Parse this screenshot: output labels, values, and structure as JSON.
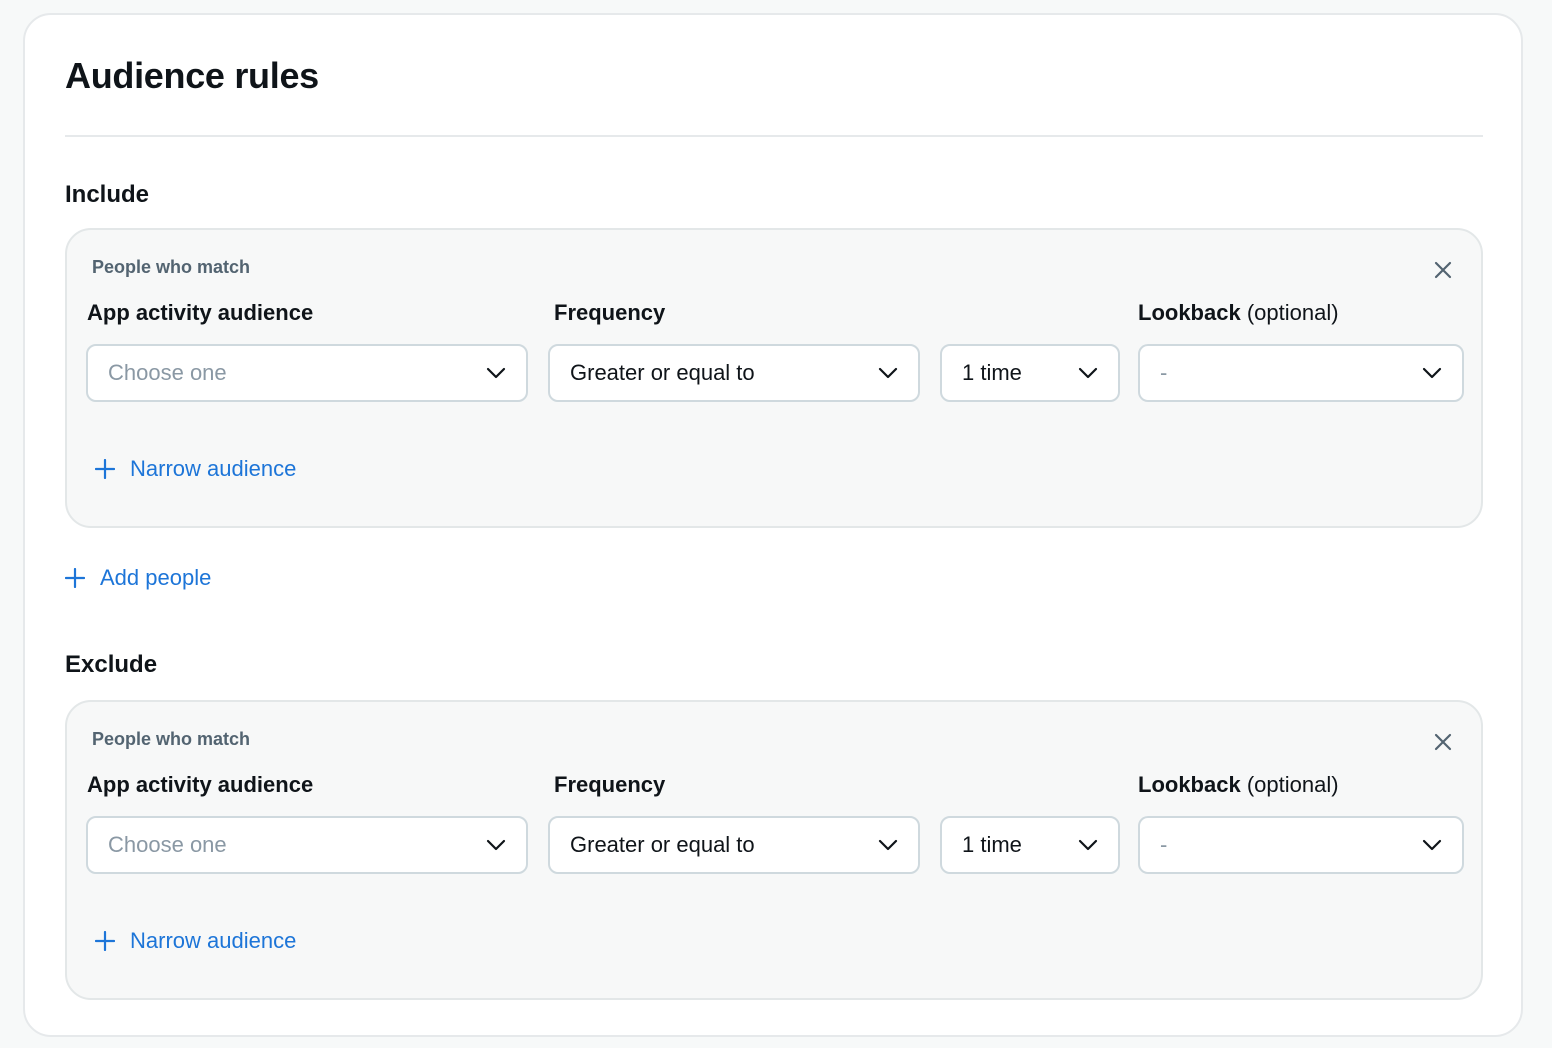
{
  "title": "Audience rules",
  "include": {
    "heading": "Include",
    "group": {
      "caption": "People who match",
      "audience_label": "App activity audience",
      "audience_placeholder": "Choose one",
      "frequency_label": "Frequency",
      "frequency_operator": "Greater or equal to",
      "frequency_count": "1 time",
      "lookback_label": "Lookback",
      "lookback_optional": "(optional)",
      "lookback_value": "-",
      "narrow_label": "Narrow audience"
    },
    "add_people_label": "Add people"
  },
  "exclude": {
    "heading": "Exclude",
    "group": {
      "caption": "People who match",
      "audience_label": "App activity audience",
      "audience_placeholder": "Choose one",
      "frequency_label": "Frequency",
      "frequency_operator": "Greater or equal to",
      "frequency_count": "1 time",
      "lookback_label": "Lookback",
      "lookback_optional": "(optional)",
      "lookback_value": "-",
      "narrow_label": "Narrow audience"
    }
  },
  "icons": {
    "close": "close-icon",
    "chevron": "chevron-down-icon",
    "plus": "plus-icon"
  },
  "colors": {
    "link": "#1d75d8",
    "text": "#0f1419",
    "muted": "#536471",
    "placeholder": "#8a98a4",
    "border": "#cfd9de",
    "group_bg": "#f7f8f8"
  }
}
